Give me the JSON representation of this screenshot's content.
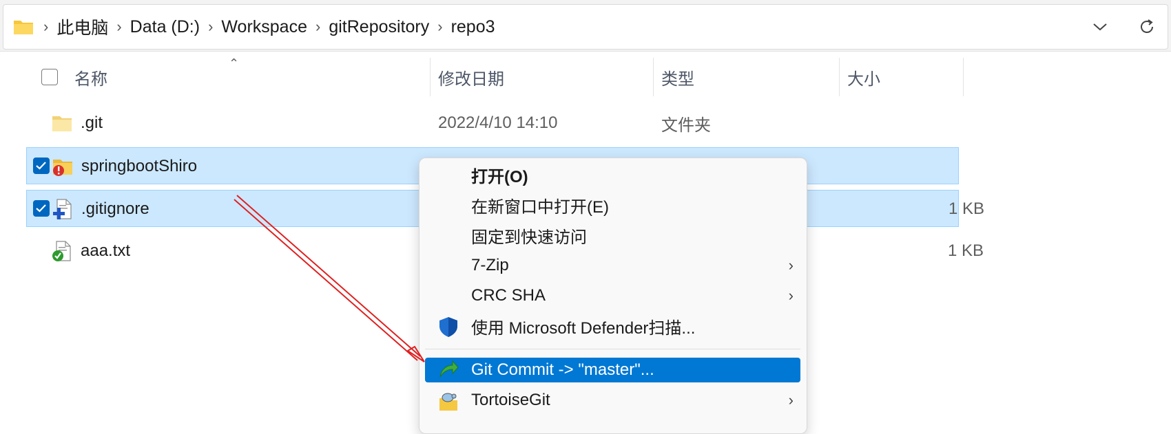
{
  "address_bar": {
    "breadcrumbs": [
      "此电脑",
      "Data (D:)",
      "Workspace",
      "gitRepository",
      "repo3"
    ],
    "history_icon": "chevron-down-icon",
    "refresh_icon": "refresh-icon"
  },
  "columns": {
    "name": "名称",
    "modified": "修改日期",
    "type": "类型",
    "size": "大小"
  },
  "files": [
    {
      "name": ".git",
      "modified": "2022/4/10 14:10",
      "type": "文件夹",
      "size": "",
      "icon": "folder-icon",
      "selected": false
    },
    {
      "name": "springbootShiro",
      "modified": "",
      "type": "",
      "size": "",
      "icon": "folder-conflict-icon",
      "selected": true
    },
    {
      "name": ".gitignore",
      "modified": "",
      "type": "",
      "size": "1 KB",
      "icon": "file-added-icon",
      "selected": true
    },
    {
      "name": "aaa.txt",
      "modified": "",
      "type": "",
      "size": "1 KB",
      "icon": "file-ok-icon",
      "selected": false
    }
  ],
  "context_menu": {
    "items": [
      {
        "label": "打开(O)",
        "bold": true
      },
      {
        "label": "在新窗口中打开(E)"
      },
      {
        "label": "固定到快速访问"
      },
      {
        "label": "7-Zip",
        "submenu": true
      },
      {
        "label": "CRC SHA",
        "submenu": true
      },
      {
        "label": "使用 Microsoft Defender扫描...",
        "icon": "defender-shield-icon"
      },
      {
        "label": "Git Commit -> \"master\"...",
        "icon": "git-commit-icon",
        "highlighted": true
      },
      {
        "label": "TortoiseGit",
        "icon": "tortoisegit-icon",
        "submenu": true
      }
    ]
  },
  "colors": {
    "selection": "#cce8ff",
    "menu_highlight": "#0078d4",
    "annotation_arrow": "#e02020"
  }
}
